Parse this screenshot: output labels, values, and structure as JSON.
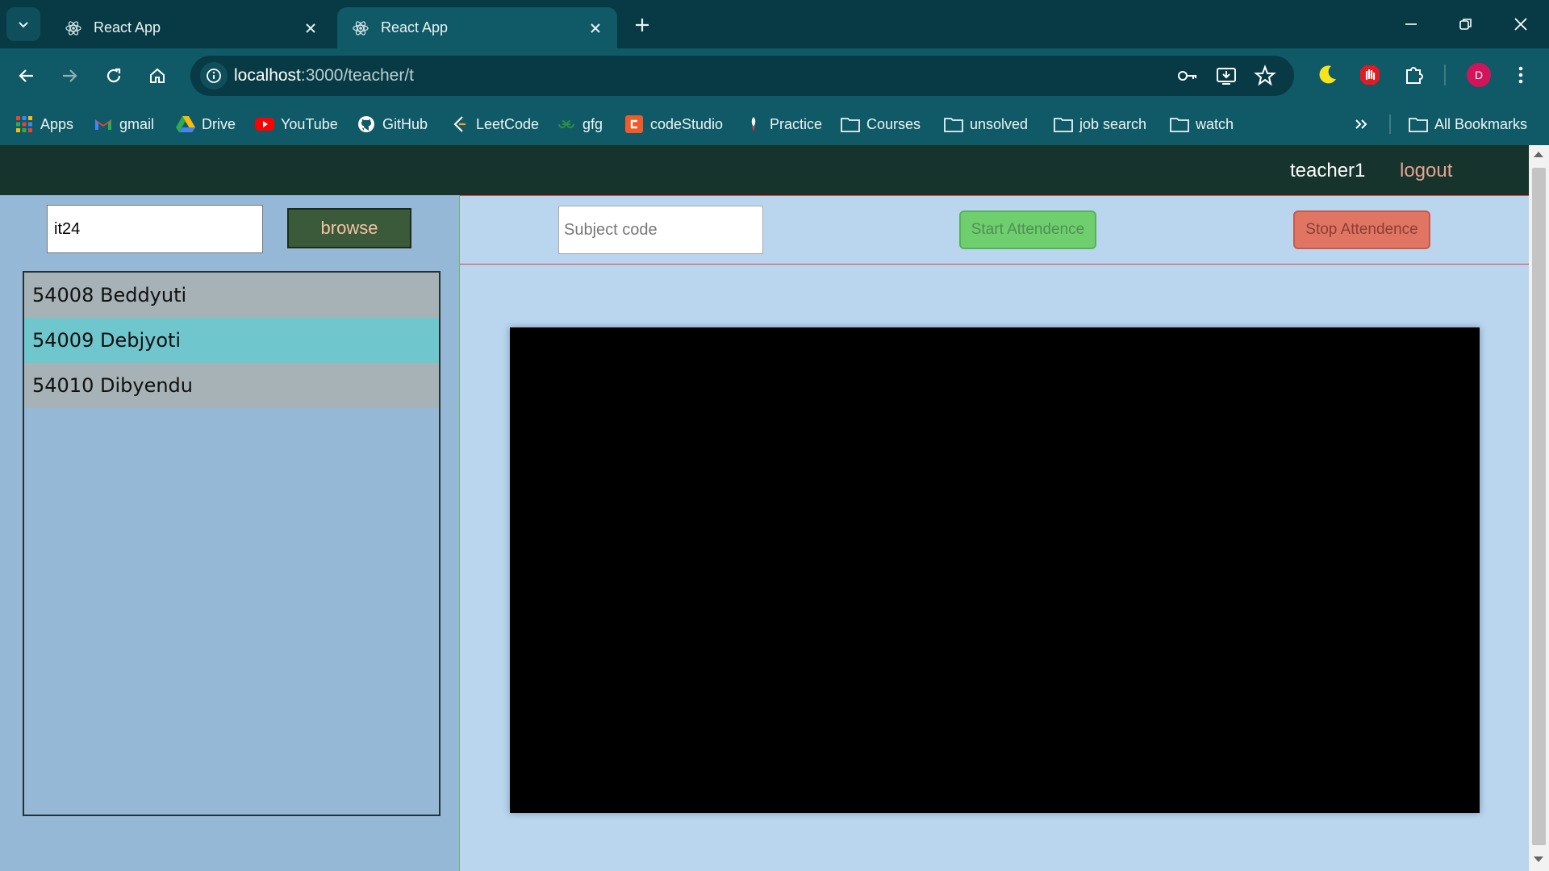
{
  "browser": {
    "tabs": [
      {
        "title": "React App",
        "active": false
      },
      {
        "title": "React App",
        "active": true
      }
    ],
    "url_host": "localhost",
    "url_path": ":3000/teacher/t",
    "profile_initial": "D",
    "bookmarks": [
      {
        "label": "Apps",
        "icon": "apps-grid-icon"
      },
      {
        "label": "gmail",
        "icon": "gmail-icon"
      },
      {
        "label": "Drive",
        "icon": "drive-icon"
      },
      {
        "label": "YouTube",
        "icon": "youtube-icon"
      },
      {
        "label": "GitHub",
        "icon": "github-icon"
      },
      {
        "label": "LeetCode",
        "icon": "leetcode-icon"
      },
      {
        "label": "gfg",
        "icon": "gfg-icon"
      },
      {
        "label": "codeStudio",
        "icon": "codestudio-icon"
      },
      {
        "label": "Practice",
        "icon": "practice-icon"
      },
      {
        "label": "Courses",
        "icon": "folder-icon"
      },
      {
        "label": "unsolved",
        "icon": "folder-icon"
      },
      {
        "label": "job search",
        "icon": "folder-icon"
      },
      {
        "label": "watch",
        "icon": "folder-icon"
      }
    ],
    "all_bookmarks_label": "All Bookmarks"
  },
  "app": {
    "header": {
      "username": "teacher1",
      "logout_label": "logout"
    },
    "left": {
      "class_input_value": "it24",
      "browse_label": "browse",
      "students": [
        {
          "text": "54008 Beddyuti"
        },
        {
          "text": "54009 Debjyoti"
        },
        {
          "text": "54010 Dibyendu"
        }
      ]
    },
    "controls": {
      "subject_placeholder": "Subject code",
      "start_label": "Start Attendence",
      "stop_label": "Stop Attendence"
    }
  },
  "colors": {
    "chrome_dark": "#073a44",
    "chrome_main": "#0f5a66",
    "app_header": "#16342b",
    "page_bg": "#b9d6ee",
    "left_panel_bg": "#95b8d6",
    "row_even": "#a7b2b6",
    "row_odd": "#6fc6cc",
    "start_button": "#6fcf6f",
    "stop_button": "#e17563"
  }
}
